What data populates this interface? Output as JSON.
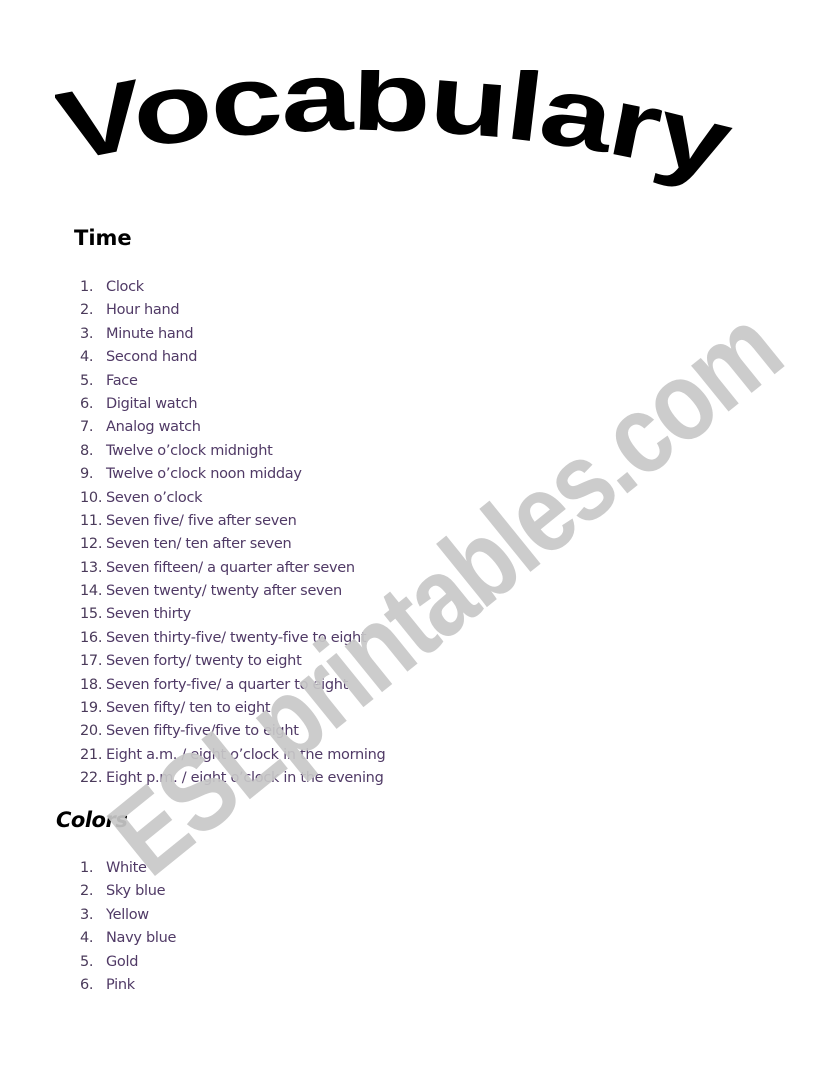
{
  "title": "Vocabulary",
  "watermark": "ESLprintables.com",
  "sections": {
    "time": {
      "heading": "Time",
      "items": [
        {
          "num": "1.",
          "text": "Clock"
        },
        {
          "num": "2.",
          "text": "Hour hand"
        },
        {
          "num": "3.",
          "text": "Minute hand"
        },
        {
          "num": "4.",
          "text": "Second hand"
        },
        {
          "num": "5.",
          "text": "Face"
        },
        {
          "num": "6.",
          "text": "Digital watch"
        },
        {
          "num": "7.",
          "text": "Analog watch"
        },
        {
          "num": "8.",
          "text": "Twelve o’clock midnight"
        },
        {
          "num": "9.",
          "text": "Twelve o’clock noon midday"
        },
        {
          "num": "10.",
          "text": "Seven o’clock"
        },
        {
          "num": "11.",
          "text": "Seven five/ five after seven"
        },
        {
          "num": "12.",
          "text": "Seven ten/ ten after seven"
        },
        {
          "num": "13.",
          "text": "Seven fifteen/ a quarter after seven"
        },
        {
          "num": "14.",
          "text": "Seven twenty/ twenty after seven"
        },
        {
          "num": "15.",
          "text": "Seven thirty"
        },
        {
          "num": "16.",
          "text": "Seven thirty-five/ twenty-five to eight"
        },
        {
          "num": "17.",
          "text": "Seven forty/ twenty to eight"
        },
        {
          "num": "18.",
          "text": "Seven forty-five/ a quarter to eight"
        },
        {
          "num": "19.",
          "text": "Seven fifty/ ten to eight"
        },
        {
          "num": "20.",
          "text": "Seven fifty-five/five to eight"
        },
        {
          "num": "21.",
          "text": "Eight  a.m. / eight o’clock in the morning"
        },
        {
          "num": "22.",
          "text": "Eight p.m. / eight o’clock in the evening"
        }
      ]
    },
    "colors": {
      "heading": "Colors",
      "items": [
        {
          "num": "1.",
          "text": "White"
        },
        {
          "num": "2.",
          "text": "Sky blue"
        },
        {
          "num": "3.",
          "text": "Yellow"
        },
        {
          "num": "4.",
          "text": "Navy blue"
        },
        {
          "num": "5.",
          "text": "Gold"
        },
        {
          "num": "6.",
          "text": "Pink"
        }
      ]
    }
  },
  "colors": {
    "list_text": "#503a66",
    "heading_text": "#000000",
    "watermark": "#c8c8c8"
  }
}
